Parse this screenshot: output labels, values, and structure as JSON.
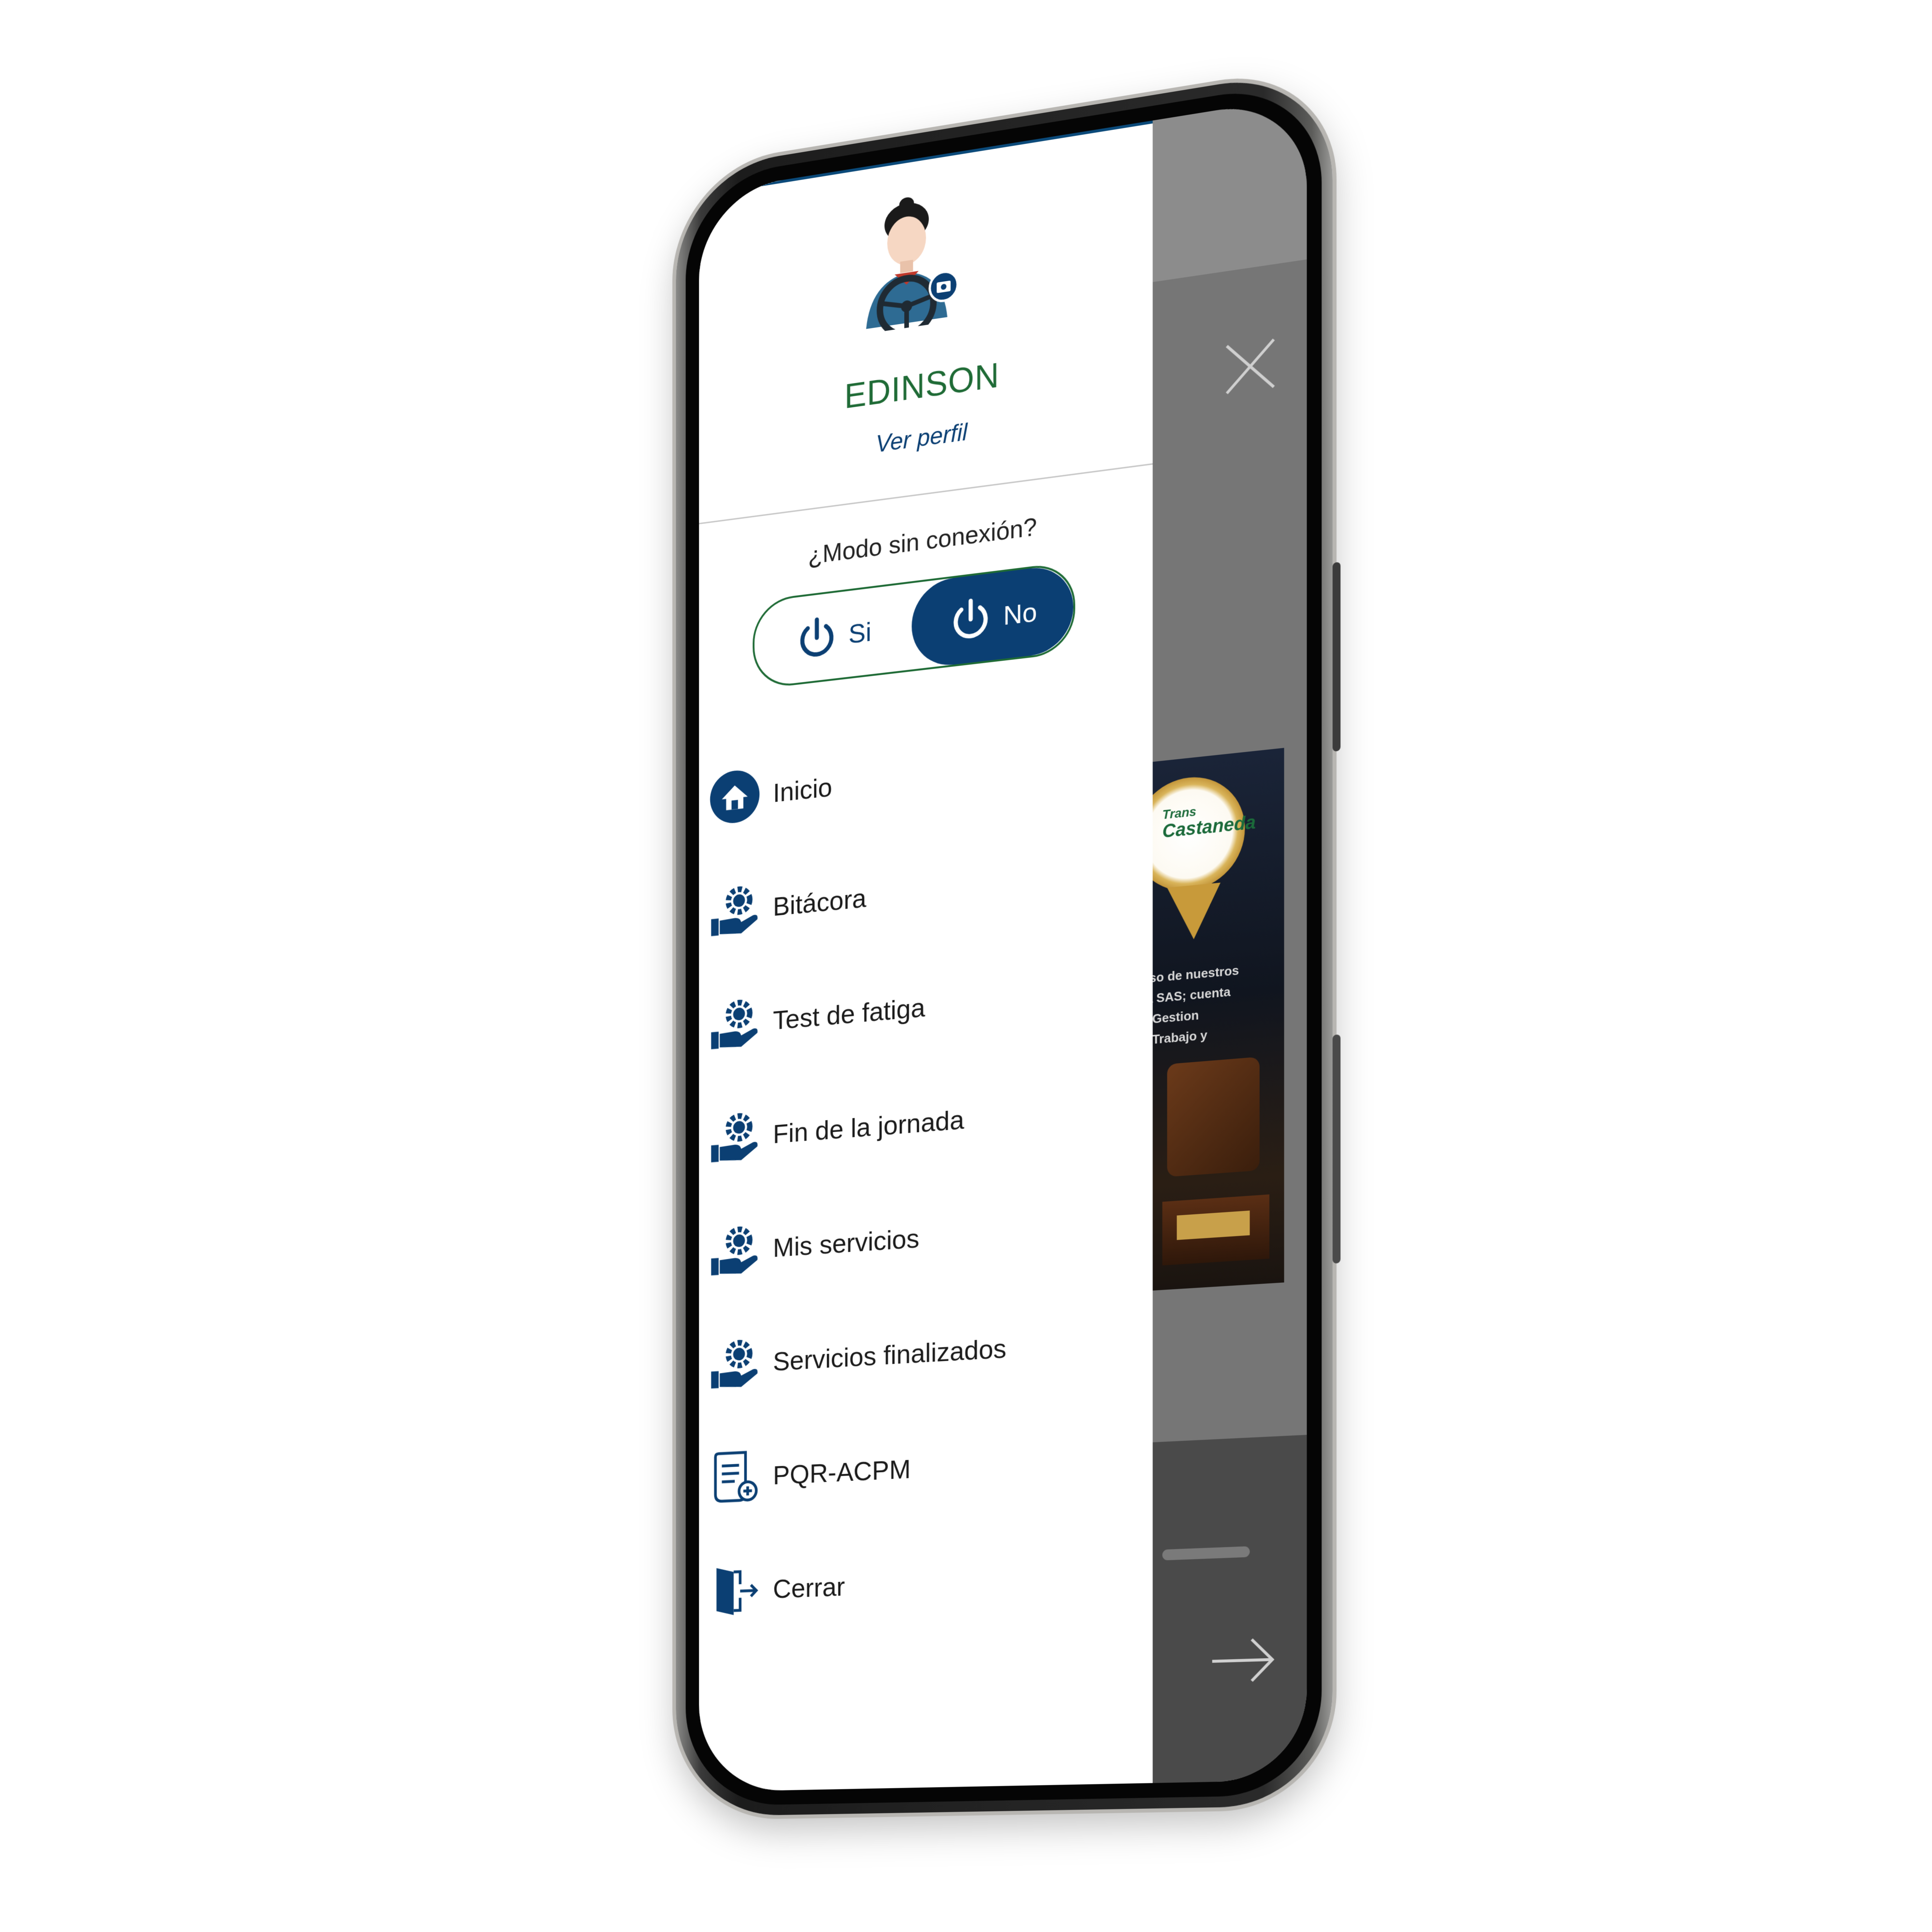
{
  "user": {
    "name": "EDINSON",
    "profile_link": "Ver perfil"
  },
  "offline_mode": {
    "question": "¿Modo sin conexión?",
    "option_yes": "Si",
    "option_no": "No",
    "selected": "No"
  },
  "menu": {
    "items": [
      {
        "label": "Inicio",
        "icon": "home-icon"
      },
      {
        "label": "Bitácora",
        "icon": "gear-hand-icon"
      },
      {
        "label": "Test de fatiga",
        "icon": "gear-hand-icon"
      },
      {
        "label": "Fin de la jornada",
        "icon": "gear-hand-icon"
      },
      {
        "label": "Mis servicios",
        "icon": "gear-hand-icon"
      },
      {
        "label": "Servicios finalizados",
        "icon": "gear-hand-icon"
      },
      {
        "label": "PQR-ACPM",
        "icon": "document-add-icon"
      },
      {
        "label": "Cerrar",
        "icon": "exit-door-icon"
      }
    ]
  },
  "background_poster": {
    "brand_line_1": "Trans",
    "brand_line_2": "Castaneda",
    "text_lines": [
      "niso de nuestros",
      "da SAS; cuenta",
      "la Gestion",
      "el Trabajo y"
    ]
  },
  "colors": {
    "primary": "#0b3f73",
    "accent_green": "#1f6b36",
    "overlay_gray": "#767676"
  }
}
